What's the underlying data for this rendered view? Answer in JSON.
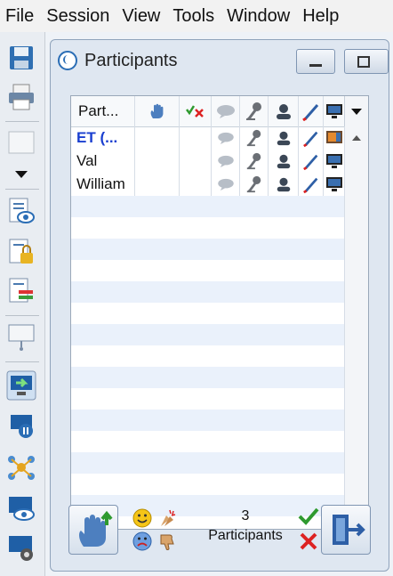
{
  "menu": {
    "items": [
      "File",
      "Session",
      "View",
      "Tools",
      "Window",
      "Help"
    ]
  },
  "panel": {
    "title": "Participants"
  },
  "grid": {
    "header_name": "Part..."
  },
  "participants": [
    {
      "name": "ET (...",
      "presenter": true
    },
    {
      "name": "Val",
      "presenter": false
    },
    {
      "name": "William",
      "presenter": false
    }
  ],
  "footer": {
    "count": "3",
    "count_label": "Participants"
  },
  "colors": {
    "presenter_name": "#1a3fd0",
    "stripe": "#eaf1fb"
  }
}
